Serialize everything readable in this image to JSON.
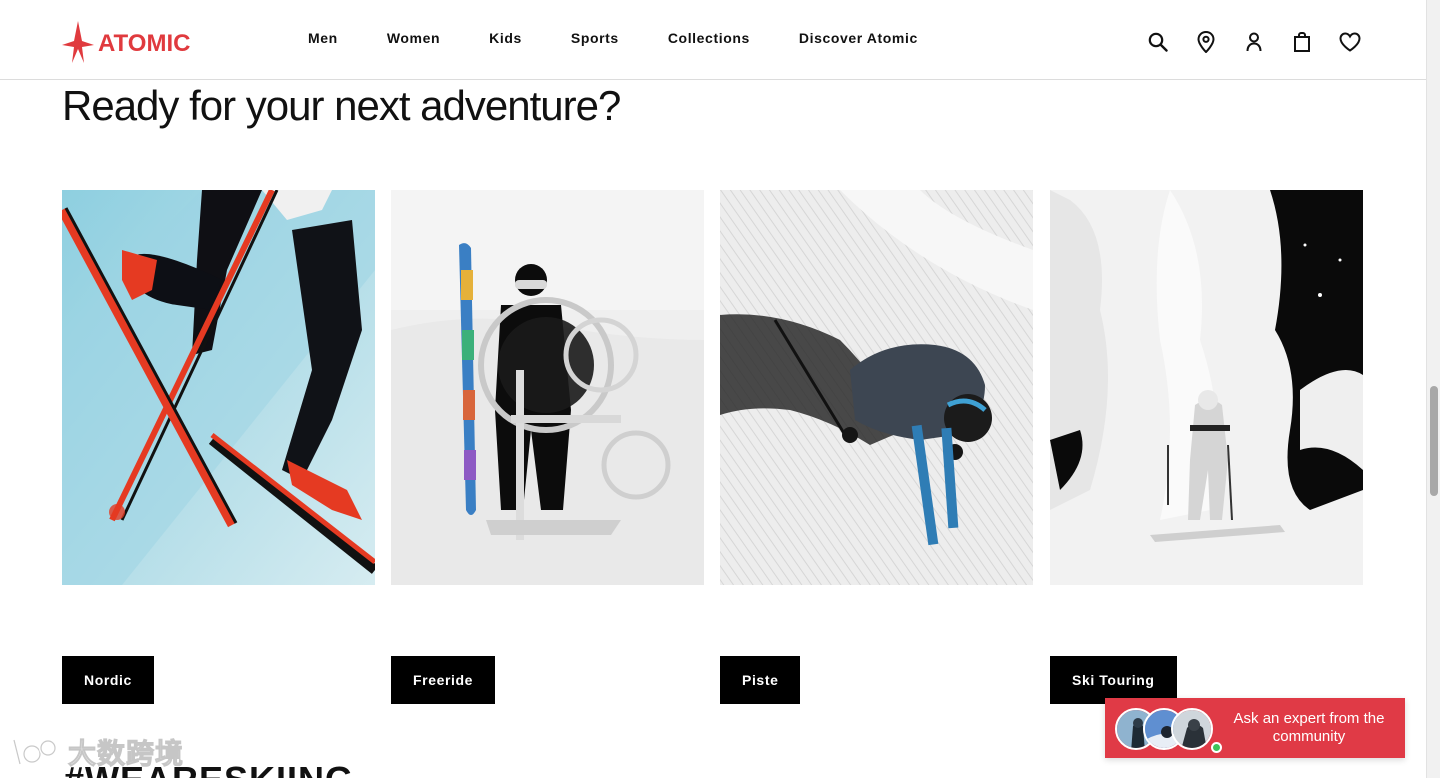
{
  "header": {
    "brand": "ATOMIC",
    "nav": [
      "Men",
      "Women",
      "Kids",
      "Sports",
      "Collections",
      "Discover Atomic"
    ],
    "icons": [
      "search-icon",
      "location-pin-icon",
      "account-icon",
      "shopping-bag-icon",
      "heart-icon"
    ]
  },
  "heading": "Ready for your next adventure?",
  "categories": [
    {
      "label": "Nordic",
      "image": "nordic-skier-photo"
    },
    {
      "label": "Freeride",
      "image": "freeride-skier-photo"
    },
    {
      "label": "Piste",
      "image": "piste-skier-photo"
    },
    {
      "label": "Ski Touring",
      "image": "ski-touring-photo"
    }
  ],
  "hashtag": "#WEARESKIING",
  "watermark": "大数跨境",
  "community": {
    "text": "Ask an expert from the community"
  },
  "colors": {
    "brand_red": "#e03a3e",
    "popup_red": "#e03a46",
    "button_bg": "#000000",
    "online_green": "#3cc35a"
  }
}
